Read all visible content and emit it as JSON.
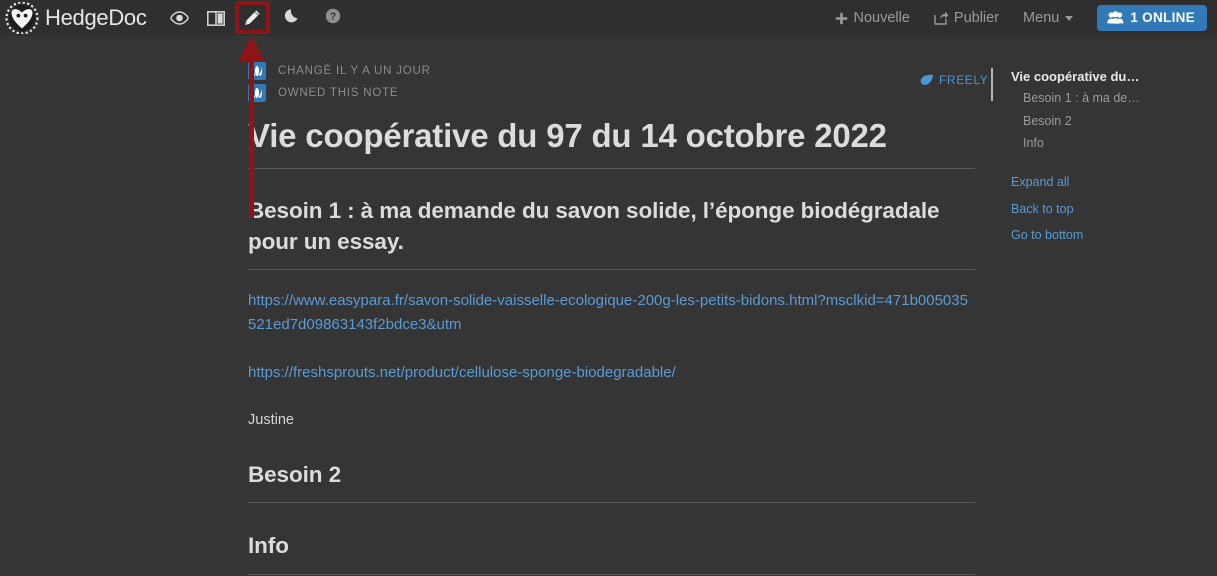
{
  "app": {
    "brand": "HedgeDoc",
    "logo_icon": "hedgehog-logo-icon"
  },
  "navbar": {
    "modes": [
      {
        "name": "view-mode",
        "icon": "eye-icon",
        "label": "View",
        "active": false
      },
      {
        "name": "both-mode",
        "icon": "columns-icon",
        "label": "Both",
        "active": false
      },
      {
        "name": "edit-mode",
        "icon": "pencil-icon",
        "label": "Edit",
        "active": true
      }
    ],
    "night_mode": {
      "icon": "moon-icon",
      "label": "Night Mode"
    },
    "help": {
      "icon": "question-circle-icon",
      "label": "Help"
    },
    "new_label": "Nouvelle",
    "new_icon": "plus-icon",
    "publish_label": "Publier",
    "publish_icon": "share-square-icon",
    "menu_label": "Menu",
    "menu_caret_icon": "chevron-down-icon",
    "online_badge": {
      "label": "1 ONLINE",
      "icon": "users-icon",
      "color": "#3279b7"
    }
  },
  "annotation": {
    "highlight_target": "edit-mode-button",
    "highlight_color": "#8e1515",
    "arrow_color": "#8e1515"
  },
  "document": {
    "meta": [
      {
        "avatar_icon": "user-avatar-icon",
        "text": "CHANGÉ IL Y A UN JOUR"
      },
      {
        "avatar_icon": "user-avatar-icon",
        "text": "OWNED THIS NOTE"
      }
    ],
    "title": "Vie coopérative du 97 du 14 octobre 2022",
    "heading_1": "Besoin 1 : à ma demande du savon solide, l’éponge biodégradale pour un essay.",
    "link_1": "https://www.easypara.fr/savon-solide-vaisselle-ecologique-200g-les-petits-bidons.html?msclkid=471b005035521ed7d09863143f2bdce3&utm",
    "link_2": "https://freshsprouts.net/product/cellulose-sponge-biodegradable/",
    "paragraph": "Justine",
    "heading_2": "Besoin 2",
    "heading_3": "Info"
  },
  "right_panel": {
    "permission": {
      "label": "FREELY",
      "icon": "leaf-icon"
    },
    "toc": [
      {
        "label": "Vie coopérative du…",
        "level": 1
      },
      {
        "label": "Besoin 1 : à ma de…",
        "level": 2
      },
      {
        "label": "Besoin 2",
        "level": 2
      },
      {
        "label": "Info",
        "level": 2
      }
    ],
    "links": [
      "Expand all",
      "Back to top",
      "Go to bottom"
    ]
  },
  "colors": {
    "navbar_bg": "#2f2f2f",
    "content_bg": "#353535",
    "accent_blue": "#5b9bd5",
    "text_primary": "#dcdcdc",
    "text_muted": "#8d8d8d"
  }
}
